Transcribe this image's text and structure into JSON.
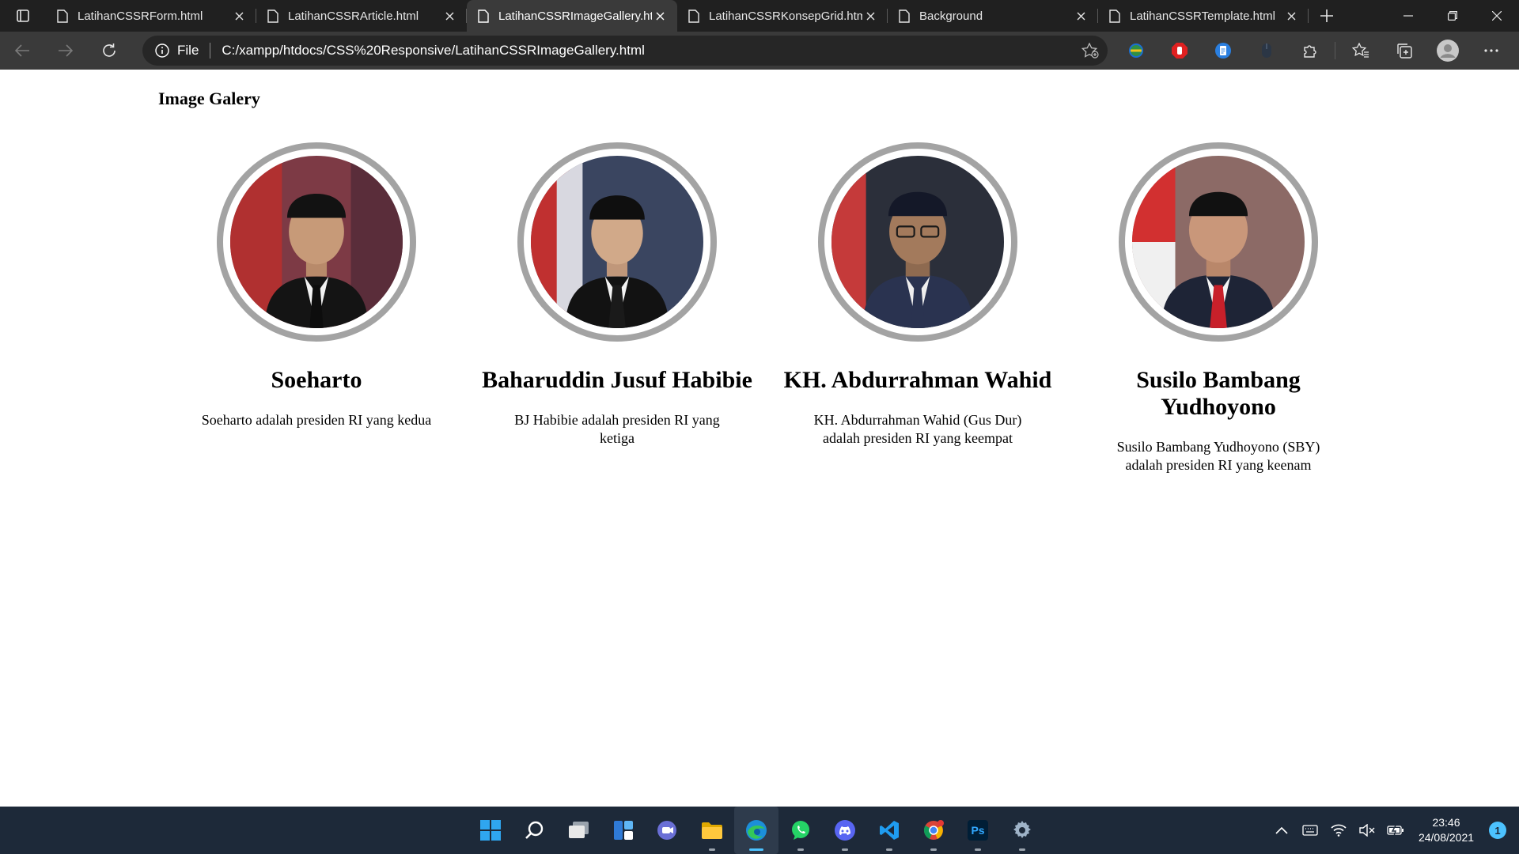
{
  "browser": {
    "tabs": [
      {
        "title": "LatihanCSSRForm.html",
        "active": false
      },
      {
        "title": "LatihanCSSRArticle.html",
        "active": false
      },
      {
        "title": "LatihanCSSRImageGallery.html",
        "active": true
      },
      {
        "title": "LatihanCSSRKonsepGrid.html",
        "active": false
      },
      {
        "title": "Background",
        "active": false
      },
      {
        "title": "LatihanCSSRTemplate.html",
        "active": false
      }
    ],
    "address": {
      "scheme_label": "File",
      "url": "C:/xampp/htdocs/CSS%20Responsive/LatihanCSSRImageGallery.html"
    }
  },
  "page": {
    "title": "Image Galery",
    "gallery": [
      {
        "name": "Soeharto",
        "description": "Soeharto adalah presiden RI yang kedua",
        "tie_color": "#0d0d0d"
      },
      {
        "name": "Baharuddin Jusuf Habibie",
        "description": "BJ Habibie adalah presiden RI yang ketiga",
        "tie_color": "#1a1a1a"
      },
      {
        "name": "KH. Abdurrahman Wahid",
        "description": "KH. Abdurrahman Wahid (Gus Dur) adalah presiden RI yang keempat",
        "tie_color": "#2a3350"
      },
      {
        "name": "Susilo Bambang Yudhoyono",
        "description": "Susilo Bambang Yudhoyono (SBY) adalah presiden RI yang keenam",
        "tie_color": "#c8202a"
      }
    ]
  },
  "taskbar": {
    "apps": [
      "start",
      "search",
      "task-view",
      "widgets",
      "chat",
      "file-explorer",
      "edge",
      "whatsapp",
      "discord",
      "vscode",
      "chrome",
      "photoshop",
      "settings"
    ],
    "photoshop_label": "Ps",
    "clock": {
      "time": "23:46",
      "date": "24/08/2021"
    },
    "notification_count": "1"
  }
}
